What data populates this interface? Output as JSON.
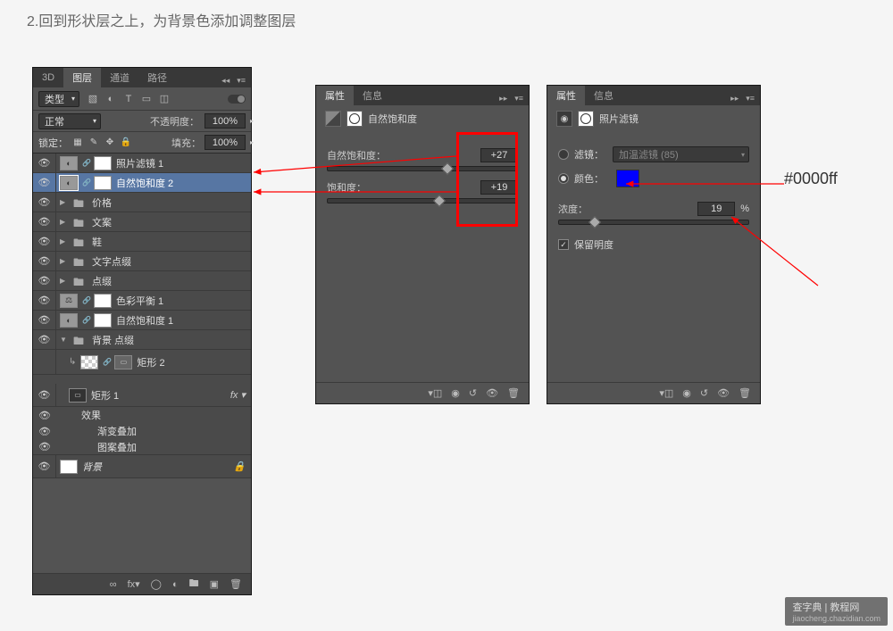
{
  "instruction": "2.回到形状层之上，为背景色添加调整图层",
  "layers_panel": {
    "tabs": [
      "3D",
      "图层",
      "通道",
      "路径"
    ],
    "active_tab": 1,
    "filter_label": "类型",
    "blend_mode": "正常",
    "opacity_label": "不透明度：",
    "opacity_value": "100%",
    "lock_label": "锁定：",
    "fill_label": "填充：",
    "fill_value": "100%",
    "layers": [
      {
        "name": "照片滤镜 1",
        "kind": "adj",
        "selected": false,
        "indent": 0
      },
      {
        "name": "自然饱和度 2",
        "kind": "adj",
        "selected": true,
        "indent": 0
      },
      {
        "name": "价格",
        "kind": "folder",
        "indent": 0
      },
      {
        "name": "文案",
        "kind": "folder",
        "indent": 0
      },
      {
        "name": "鞋",
        "kind": "folder",
        "indent": 0
      },
      {
        "name": "文字点缀",
        "kind": "folder",
        "indent": 0
      },
      {
        "name": "点缀",
        "kind": "folder",
        "indent": 0
      },
      {
        "name": "色彩平衡 1",
        "kind": "adj",
        "indent": 0
      },
      {
        "name": "自然饱和度 1",
        "kind": "adj",
        "indent": 0
      },
      {
        "name": "背景 点缀",
        "kind": "folder-open",
        "indent": 0
      },
      {
        "name": "矩形 2",
        "kind": "shape",
        "indent": 1,
        "clipped": true
      },
      {
        "name": "矩形 1",
        "kind": "shape-fx",
        "indent": 1,
        "fx": true
      },
      {
        "name": "效果",
        "kind": "fx-head",
        "indent": 2
      },
      {
        "name": "渐变叠加",
        "kind": "fx-item",
        "indent": 3
      },
      {
        "name": "图案叠加",
        "kind": "fx-item",
        "indent": 3
      },
      {
        "name": "背景",
        "kind": "bg",
        "indent": 0,
        "italic": true
      }
    ]
  },
  "vibrance_panel": {
    "tabs": [
      "属性",
      "信息"
    ],
    "title": "自然饱和度",
    "vibrance_label": "自然饱和度：",
    "vibrance_value": "+27",
    "saturation_label": "饱和度：",
    "saturation_value": "+19"
  },
  "photofilter_panel": {
    "tabs": [
      "属性",
      "信息"
    ],
    "title": "照片滤镜",
    "filter_label": "滤镜：",
    "filter_value": "加温滤镜 (85)",
    "color_label": "颜色：",
    "color_value": "#0000ff",
    "density_label": "浓度：",
    "density_value": "19",
    "density_unit": "%",
    "preserve_label": "保留明度"
  },
  "annotation": "#0000ff",
  "watermark": {
    "title": "查字典 | 教程网",
    "sub": "jiaocheng.chazidian.com"
  }
}
